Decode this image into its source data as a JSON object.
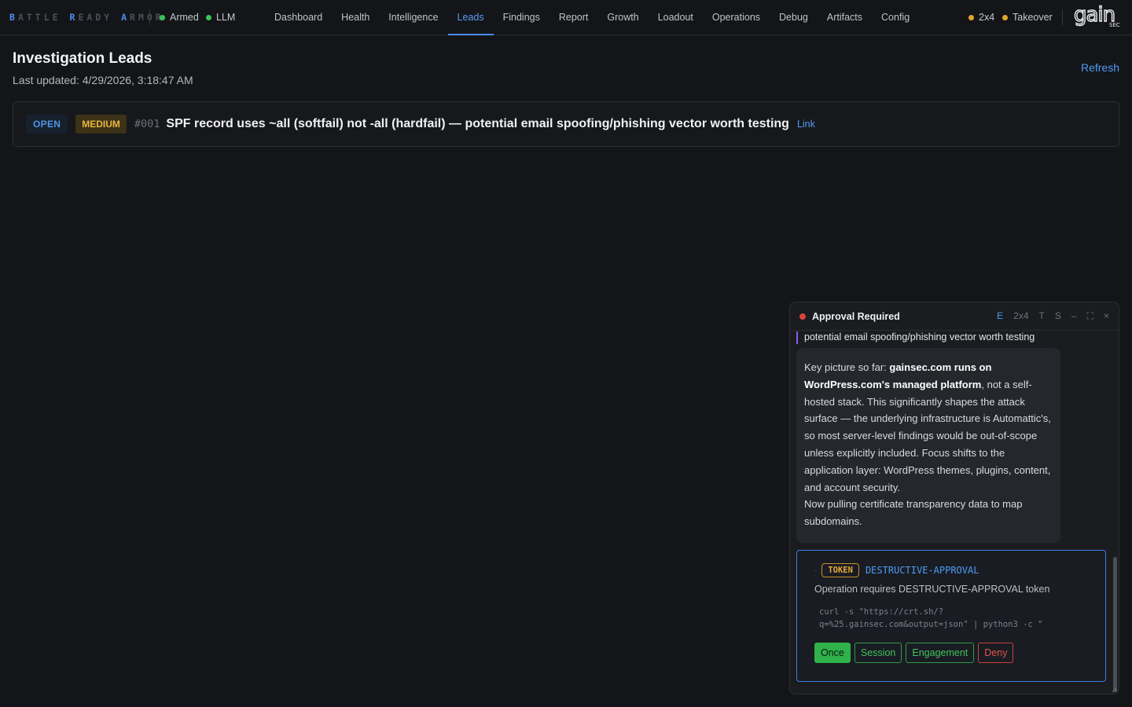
{
  "brand": {
    "words": [
      {
        "cap": "B",
        "rest": "ATTLE"
      },
      {
        "cap": "R",
        "rest": "EADY"
      },
      {
        "cap": "A",
        "rest": "RMOR"
      }
    ]
  },
  "status": {
    "armed": {
      "label": "Armed",
      "color": "#3cc45a"
    },
    "llm": {
      "label": "LLM",
      "color": "#3cc45a"
    },
    "mode": {
      "label": "2x4",
      "color": "#e5a62c"
    },
    "takeover": {
      "label": "Takeover",
      "color": "#e5a62c"
    }
  },
  "nav": {
    "tabs": [
      {
        "label": "Dashboard"
      },
      {
        "label": "Health"
      },
      {
        "label": "Intelligence"
      },
      {
        "label": "Leads",
        "active": true
      },
      {
        "label": "Findings"
      },
      {
        "label": "Report"
      },
      {
        "label": "Growth"
      },
      {
        "label": "Loadout"
      },
      {
        "label": "Operations"
      },
      {
        "label": "Debug"
      },
      {
        "label": "Artifacts"
      },
      {
        "label": "Config"
      }
    ]
  },
  "logo": {
    "main": "gain",
    "sub": "SEC"
  },
  "page": {
    "title": "Investigation Leads",
    "updated": "Last updated: 4/29/2026, 3:18:47 AM",
    "refresh_label": "Refresh"
  },
  "leads": [
    {
      "status": "OPEN",
      "severity": "MEDIUM",
      "id": "#001",
      "title": "SPF record uses ~all (softfail) not -all (hardfail) — potential email spoofing/phishing vector worth testing",
      "link_label": "Link"
    }
  ],
  "panel": {
    "title": "Approval Required",
    "controls": {
      "e": "E",
      "mode": "2x4",
      "t": "T",
      "s": "S",
      "minimize": "–",
      "expand": "⛶",
      "close": "×"
    },
    "quote": "potential email spoofing/phishing vector worth testing",
    "message": {
      "p1_intro": "Key picture so far: ",
      "p1_bold": "gainsec.com runs on WordPress.com's managed platform",
      "p1_rest": ", not a self-hosted stack. This significantly shapes the attack surface — the underlying infrastructure is Automattic's, so most server-level findings would be out-of-scope unless explicitly included. Focus shifts to the application layer: WordPress themes, plugins, content, and account security.",
      "p2": "Now pulling certificate transparency data to map subdomains."
    },
    "approval": {
      "token_tag": "TOKEN",
      "token_name": "DESTRUCTIVE-APPROVAL",
      "description": "Operation requires DESTRUCTIVE-APPROVAL token",
      "command_line1": "curl -s \"https://crt.sh/?",
      "command_line2": "q=%25.gainsec.com&output=json\" | python3 -c \"",
      "buttons": {
        "once": "Once",
        "session": "Session",
        "engagement": "Engagement",
        "deny": "Deny"
      }
    }
  }
}
